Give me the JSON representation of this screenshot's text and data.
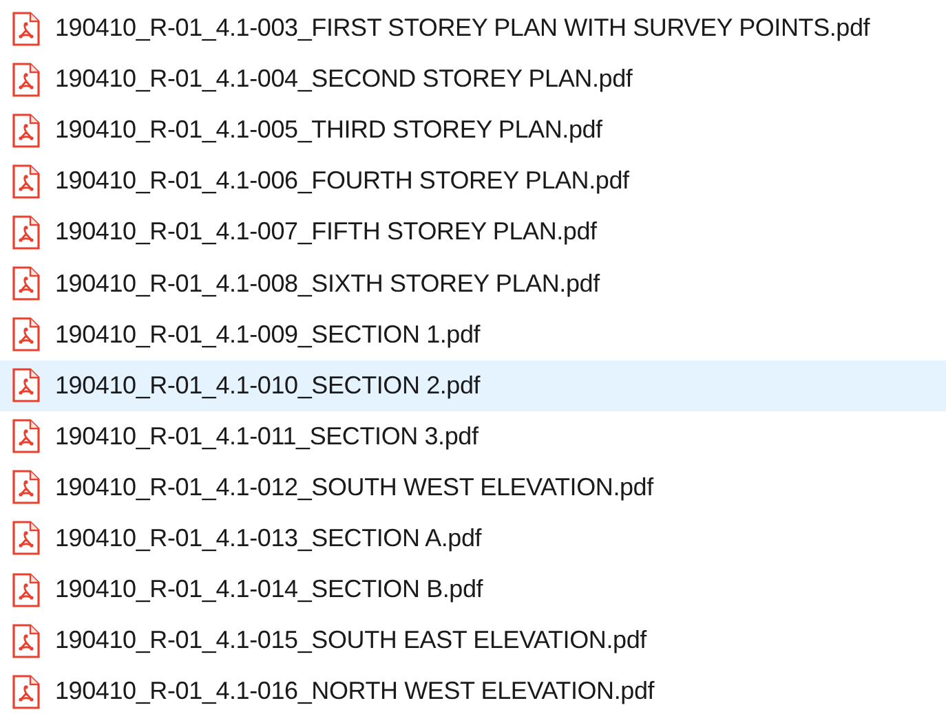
{
  "files": [
    {
      "name": "190410_R-01_4.1-003_FIRST STOREY PLAN WITH SURVEY POINTS.pdf",
      "selected": false
    },
    {
      "name": "190410_R-01_4.1-004_SECOND STOREY PLAN.pdf",
      "selected": false
    },
    {
      "name": "190410_R-01_4.1-005_THIRD STOREY PLAN.pdf",
      "selected": false
    },
    {
      "name": "190410_R-01_4.1-006_FOURTH STOREY PLAN.pdf",
      "selected": false
    },
    {
      "name": "190410_R-01_4.1-007_FIFTH STOREY PLAN.pdf",
      "selected": false
    },
    {
      "name": "190410_R-01_4.1-008_SIXTH STOREY PLAN.pdf",
      "selected": false
    },
    {
      "name": "190410_R-01_4.1-009_SECTION 1.pdf",
      "selected": false
    },
    {
      "name": "190410_R-01_4.1-010_SECTION 2.pdf",
      "selected": true
    },
    {
      "name": "190410_R-01_4.1-011_SECTION 3.pdf",
      "selected": false
    },
    {
      "name": "190410_R-01_4.1-012_SOUTH WEST ELEVATION.pdf",
      "selected": false
    },
    {
      "name": "190410_R-01_4.1-013_SECTION A.pdf",
      "selected": false
    },
    {
      "name": "190410_R-01_4.1-014_SECTION B.pdf",
      "selected": false
    },
    {
      "name": "190410_R-01_4.1-015_SOUTH EAST ELEVATION.pdf",
      "selected": false
    },
    {
      "name": "190410_R-01_4.1-016_NORTH WEST ELEVATION.pdf",
      "selected": false
    }
  ]
}
